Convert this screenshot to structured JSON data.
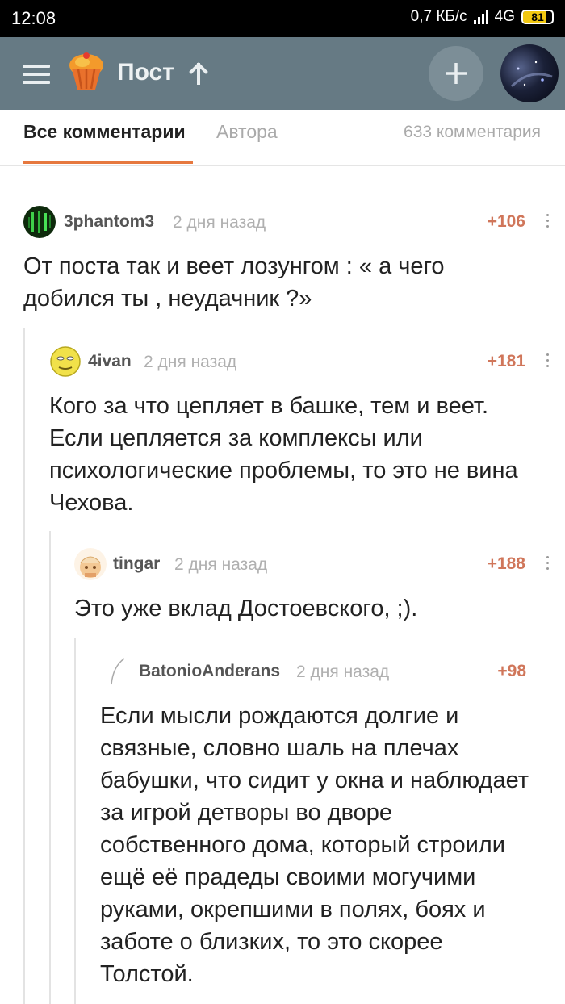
{
  "status_bar": {
    "time": "12:08",
    "network_speed": "0,7 КБ/с",
    "network_type": "4G",
    "battery_level": "81"
  },
  "app_bar": {
    "title": "Пост",
    "icons": [
      "menu-icon",
      "cupcake-logo-icon",
      "arrow-up-icon",
      "plus-icon"
    ],
    "brand_color": "#e6783f",
    "bar_color": "#667a84"
  },
  "tabs": {
    "all_label": "Все комментарии",
    "author_label": "Автора",
    "comment_count": "633 комментария",
    "active": "all"
  },
  "comments": [
    {
      "username": "3phantom3",
      "time": "2 дня назад",
      "rating": "+106",
      "text": "От поста так и веет лозунгом : « а чего добился ты , неудачник ?»",
      "avatar": "green-matrix-avatar-icon"
    },
    {
      "username": "4ivan",
      "time": "2 дня назад",
      "rating": "+181",
      "text": "Кого за что цепляет в башке, тем и веет. Если цепляется за комплексы или психологические проблемы, то это не вина Чехова.",
      "avatar": "yellow-face-avatar-icon"
    },
    {
      "username": "tingar",
      "time": "2 дня назад",
      "rating": "+188",
      "text": "Это уже вклад Достоевского, ;).",
      "avatar": "peach-character-avatar-icon"
    },
    {
      "username": "BatonioAnderans",
      "time": "2 дня назад",
      "rating": "+98",
      "text": "Если мысли рождаются долгие и связные, словно шаль на плечах бабушки, что сидит у окна и наблюдает за игрой детворы во дворе собственного дома, который строили ещё её прадеды своими могучими руками, окрепшими в полях, боях и заботе о близких, то это скорее Толстой.",
      "avatar": "feather-avatar-icon"
    }
  ]
}
